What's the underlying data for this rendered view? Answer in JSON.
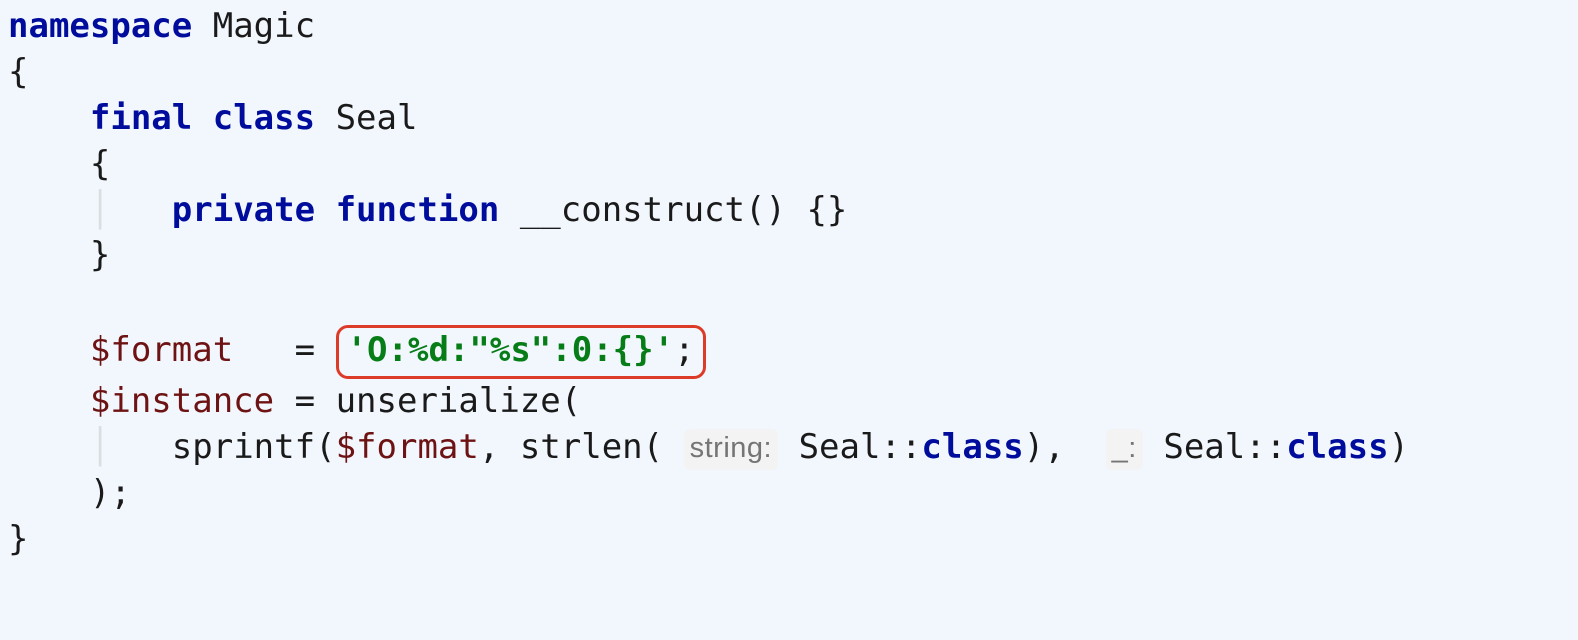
{
  "code": {
    "kw_namespace": "namespace",
    "ns_name": "Magic",
    "open_brace": "{",
    "kw_final": "final",
    "kw_class": "class",
    "class_name": "Seal",
    "class_open": "{",
    "kw_private": "private",
    "kw_function": "function",
    "ctor_name": "__construct",
    "ctor_parens": "()",
    "ctor_body": "{}",
    "class_close": "}",
    "var_format": "$format",
    "assign": "=",
    "str_format": "'O:%d:\"%s\":0:{}'",
    "semicolon": ";",
    "var_instance": "$instance",
    "fn_unserialize": "unserialize",
    "fn_sprintf": "sprintf",
    "fn_strlen": "strlen",
    "hint_string": "string:",
    "hint_under": "_:",
    "seal_class1": "Seal",
    "seal_class2": "Seal",
    "dcolon": "::",
    "kw_classref": "class",
    "close_paren": ")",
    "stmt_close": ");",
    "ns_close": "}"
  }
}
